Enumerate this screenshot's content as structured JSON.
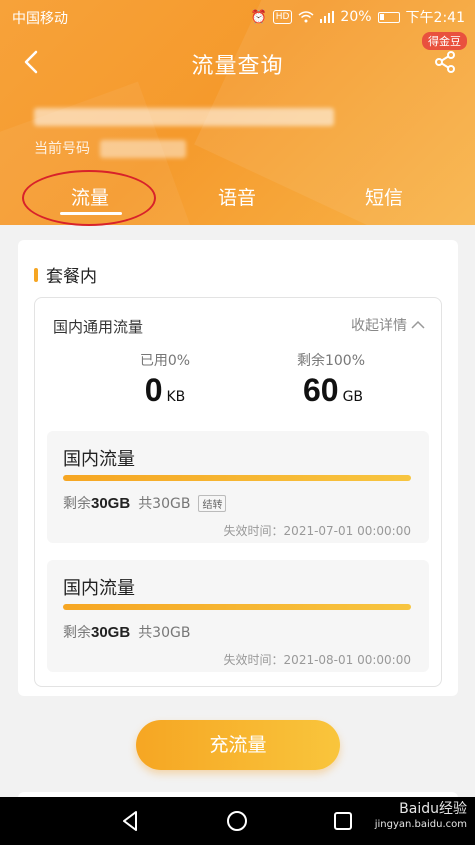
{
  "status_bar": {
    "carrier": "中国移动",
    "battery": "20%",
    "time": "下午2:41",
    "hd": "HD"
  },
  "header": {
    "title": "流量查询",
    "badge": "得金豆",
    "phone_label": "当前号码",
    "tabs": [
      "流量",
      "语音",
      "短信"
    ]
  },
  "section": {
    "title": "套餐内",
    "inner_title": "国内通用流量",
    "collapse_label": "收起详情",
    "used_label": "已用0%",
    "used_value": "0",
    "used_unit": "KB",
    "remain_label": "剩余100%",
    "remain_value": "60",
    "remain_unit": "GB"
  },
  "packages": [
    {
      "title": "国内流量",
      "remain_prefix": "剩余",
      "remain": "30GB",
      "total": "共30GB",
      "badge": "结转",
      "expire": "失效时间：2021-07-01 00:00:00",
      "fill_percent": 100
    },
    {
      "title": "国内流量",
      "remain_prefix": "剩余",
      "remain": "30GB",
      "total": "共30GB",
      "badge": "",
      "expire": "失效时间：2021-08-01 00:00:00",
      "fill_percent": 100
    }
  ],
  "recharge_label": "充流量",
  "watermark": {
    "brand": "Baidu经验",
    "url": "jingyan.baidu.com"
  },
  "colors": {
    "header": "#f59a2c",
    "accent": "#f6a623",
    "annotation": "#d8222a"
  },
  "icons": {
    "back": "chevron-left-icon",
    "share": "share-icon",
    "collapse": "chevron-up-icon"
  }
}
